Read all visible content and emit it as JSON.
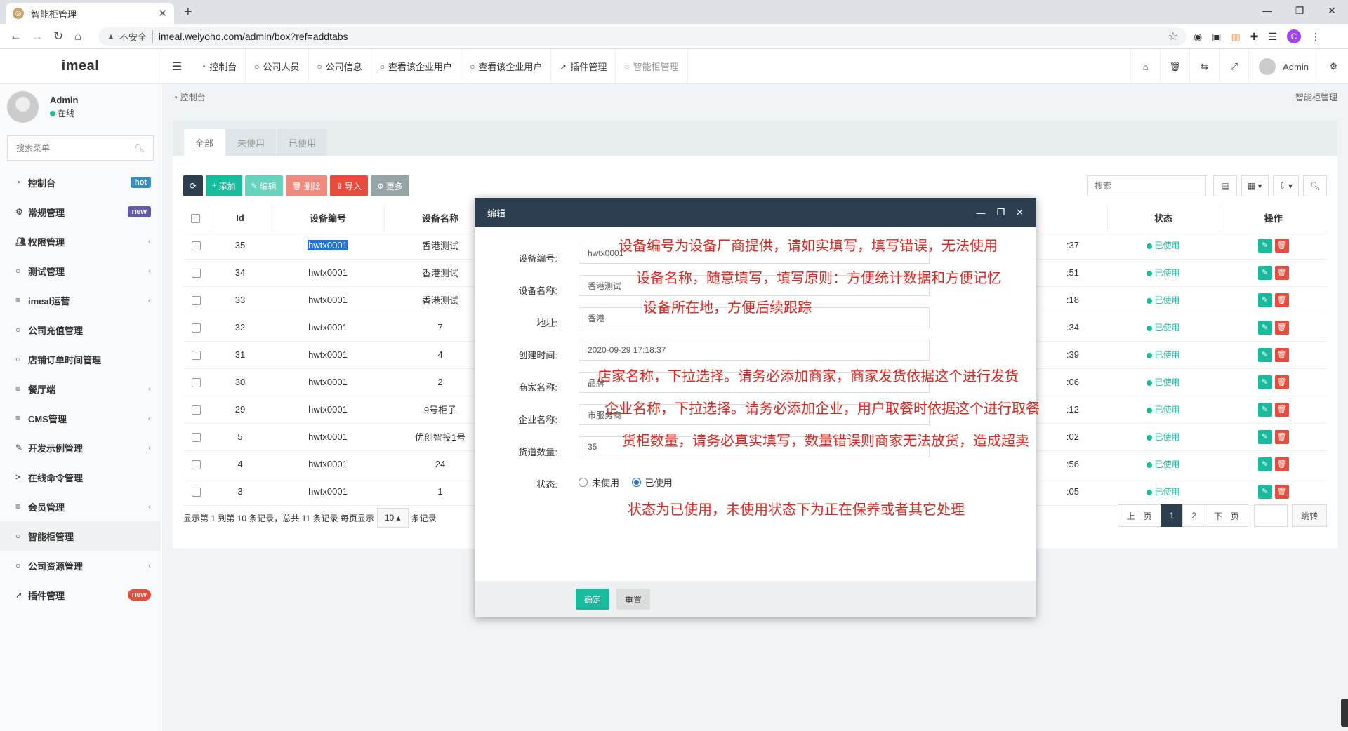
{
  "browser": {
    "tab_title": "智能柜管理",
    "insecure_label": "不安全",
    "url": "imeal.weiyoho.com/admin/box?ref=addtabs",
    "profile_initial": "C"
  },
  "header": {
    "logo": "imeal",
    "tabs": [
      {
        "icon": "dashboard-icon",
        "label": "控制台"
      },
      {
        "icon": "circle-icon",
        "label": "公司人员"
      },
      {
        "icon": "circle-icon",
        "label": "公司信息"
      },
      {
        "icon": "circle-icon",
        "label": "查看该企业用户"
      },
      {
        "icon": "circle-icon",
        "label": "查看该企业用户"
      },
      {
        "icon": "rocket-icon",
        "label": "插件管理"
      },
      {
        "icon": "circle-icon",
        "label": "智能柜管理"
      }
    ],
    "user": "Admin"
  },
  "sidebar": {
    "user_name": "Admin",
    "user_status": "在线",
    "search_placeholder": "搜索菜单",
    "items": [
      {
        "icon": "dashboard-icon",
        "label": "控制台",
        "badge": "hot"
      },
      {
        "icon": "gears-icon",
        "label": "常规管理",
        "badge": "new"
      },
      {
        "icon": "users-icon",
        "label": "权限管理",
        "chevron": "‹"
      },
      {
        "icon": "circle-icon",
        "label": "测试管理",
        "chevron": "‹"
      },
      {
        "icon": "list-icon",
        "label": "imeal运营",
        "chevron": "‹"
      },
      {
        "icon": "circle-icon",
        "label": "公司充值管理"
      },
      {
        "icon": "circle-icon",
        "label": "店铺订单时间管理"
      },
      {
        "icon": "list-icon",
        "label": "餐厅端",
        "chevron": "‹"
      },
      {
        "icon": "list-icon",
        "label": "CMS管理",
        "chevron": "‹"
      },
      {
        "icon": "magic-icon",
        "label": "开发示例管理",
        "chevron": "‹"
      },
      {
        "icon": "terminal-icon",
        "label": "在线命令管理"
      },
      {
        "icon": "list-icon",
        "label": "会员管理",
        "chevron": "‹"
      },
      {
        "icon": "circle-icon",
        "label": "智能柜管理"
      },
      {
        "icon": "circle-icon",
        "label": "公司资源管理",
        "chevron": "‹"
      },
      {
        "icon": "rocket-icon",
        "label": "插件管理",
        "badge": "new"
      }
    ]
  },
  "content": {
    "breadcrumb": "控制台",
    "breadcrumb_right": "智能柜管理",
    "filter_tabs": [
      "全部",
      "未使用",
      "已使用"
    ],
    "toolbar": {
      "refresh": "",
      "add": "添加",
      "edit": "编辑",
      "delete": "删除",
      "import": "导入",
      "more": "更多",
      "search_placeholder": "搜索"
    },
    "table": {
      "headers": [
        "Id",
        "设备编号",
        "设备名称",
        "状态",
        "操作"
      ],
      "rows": [
        {
          "id": "35",
          "code": "hwtx0001",
          "name": "香港测试",
          "time": ":37",
          "status": "已使用"
        },
        {
          "id": "34",
          "code": "hwtx0001",
          "name": "香港测试",
          "time": ":51",
          "status": "已使用"
        },
        {
          "id": "33",
          "code": "hwtx0001",
          "name": "香港测试",
          "time": ":18",
          "status": "已使用"
        },
        {
          "id": "32",
          "code": "hwtx0001",
          "name": "7",
          "time": ":34",
          "status": "已使用"
        },
        {
          "id": "31",
          "code": "hwtx0001",
          "name": "4",
          "time": ":39",
          "status": "已使用"
        },
        {
          "id": "30",
          "code": "hwtx0001",
          "name": "2",
          "time": ":06",
          "status": "已使用"
        },
        {
          "id": "29",
          "code": "hwtx0001",
          "name": "9号柜子",
          "time": ":12",
          "status": "已使用"
        },
        {
          "id": "5",
          "code": "hwtx0001",
          "name": "优创智投1号",
          "time": ":02",
          "status": "已使用"
        },
        {
          "id": "4",
          "code": "hwtx0001",
          "name": "24",
          "time": ":56",
          "status": "已使用"
        },
        {
          "id": "3",
          "code": "hwtx0001",
          "name": "1",
          "time": ":05",
          "status": "已使用"
        }
      ]
    },
    "page_info_left": "显示第 1 到第 10 条记录，总共 11 条记录 每页显示",
    "page_size": "10",
    "page_info_right": "条记录",
    "pagination": {
      "prev": "上一页",
      "pages": [
        "1",
        "2"
      ],
      "next": "下一页",
      "jump": "跳转"
    }
  },
  "modal": {
    "title": "编辑",
    "fields": [
      {
        "label": "设备编号:",
        "value": "hwtx0001"
      },
      {
        "label": "设备名称:",
        "value": "香港测试"
      },
      {
        "label": "地址:",
        "value": "香港"
      },
      {
        "label": "创建时间:",
        "value": "2020-09-29 17:18:37"
      },
      {
        "label": "商家名称:",
        "value": "品牌"
      },
      {
        "label": "企业名称:",
        "value": "市服务商"
      },
      {
        "label": "货道数量:",
        "value": "35"
      }
    ],
    "status_label": "状态:",
    "status_options": [
      "未使用",
      "已使用"
    ],
    "status_selected": "已使用",
    "notes": [
      "设备编号为设备厂商提供，请如实填写，填写错误，无法使用",
      "设备名称，随意填写，填写原则：方便统计数据和方便记忆",
      "设备所在地，方便后续跟踪",
      "店家名称，下拉选择。请务必添加商家，商家发货依据这个进行发货",
      "企业名称，下拉选择。请务必添加企业，用户取餐时依据这个进行取餐",
      "货柜数量，请务必真实填写，数量错误则商家无法放货，造成超卖",
      "状态为已使用，未使用状态下为正在保养或者其它处理"
    ],
    "ok": "确定",
    "reset": "重置"
  }
}
